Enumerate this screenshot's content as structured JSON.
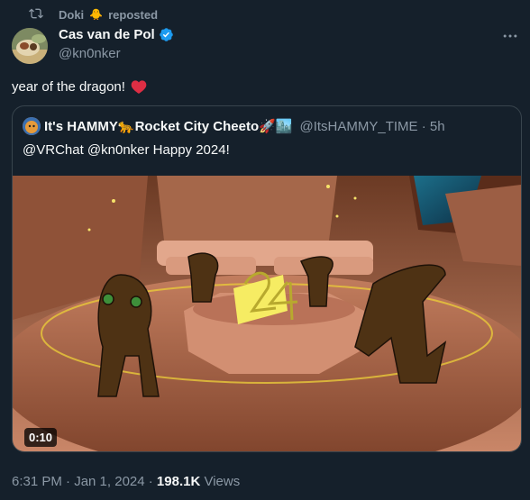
{
  "repost": {
    "name": "Doki",
    "emoji": "🐥",
    "label": "reposted"
  },
  "author": {
    "name": "Cas van de Pol",
    "handle": "@kn0nker"
  },
  "tweet": {
    "text": "year of the dragon!"
  },
  "quote": {
    "name": "It's HAMMY🐆Rocket City Cheeto🚀🏙️",
    "handle": "@ItsHAMMY_TIME · 5h",
    "text": "@VRChat @kn0nker Happy 2024!",
    "video_overlay_number": "24",
    "duration": "0:10"
  },
  "meta": {
    "time": "6:31 PM · Jan 1, 2024 · ",
    "views_count": "198.1K",
    "views_label": " Views"
  },
  "colors": {
    "background": "#15202b",
    "text": "#f7f9f9",
    "secondary": "#8b98a5",
    "verified": "#1d9bf0",
    "heart": "#f91880",
    "border": "#38444d"
  },
  "icons": {
    "repost": "repost-icon",
    "verified": "verified-badge-icon",
    "more": "more-options-icon",
    "heart": "red-heart-icon"
  }
}
